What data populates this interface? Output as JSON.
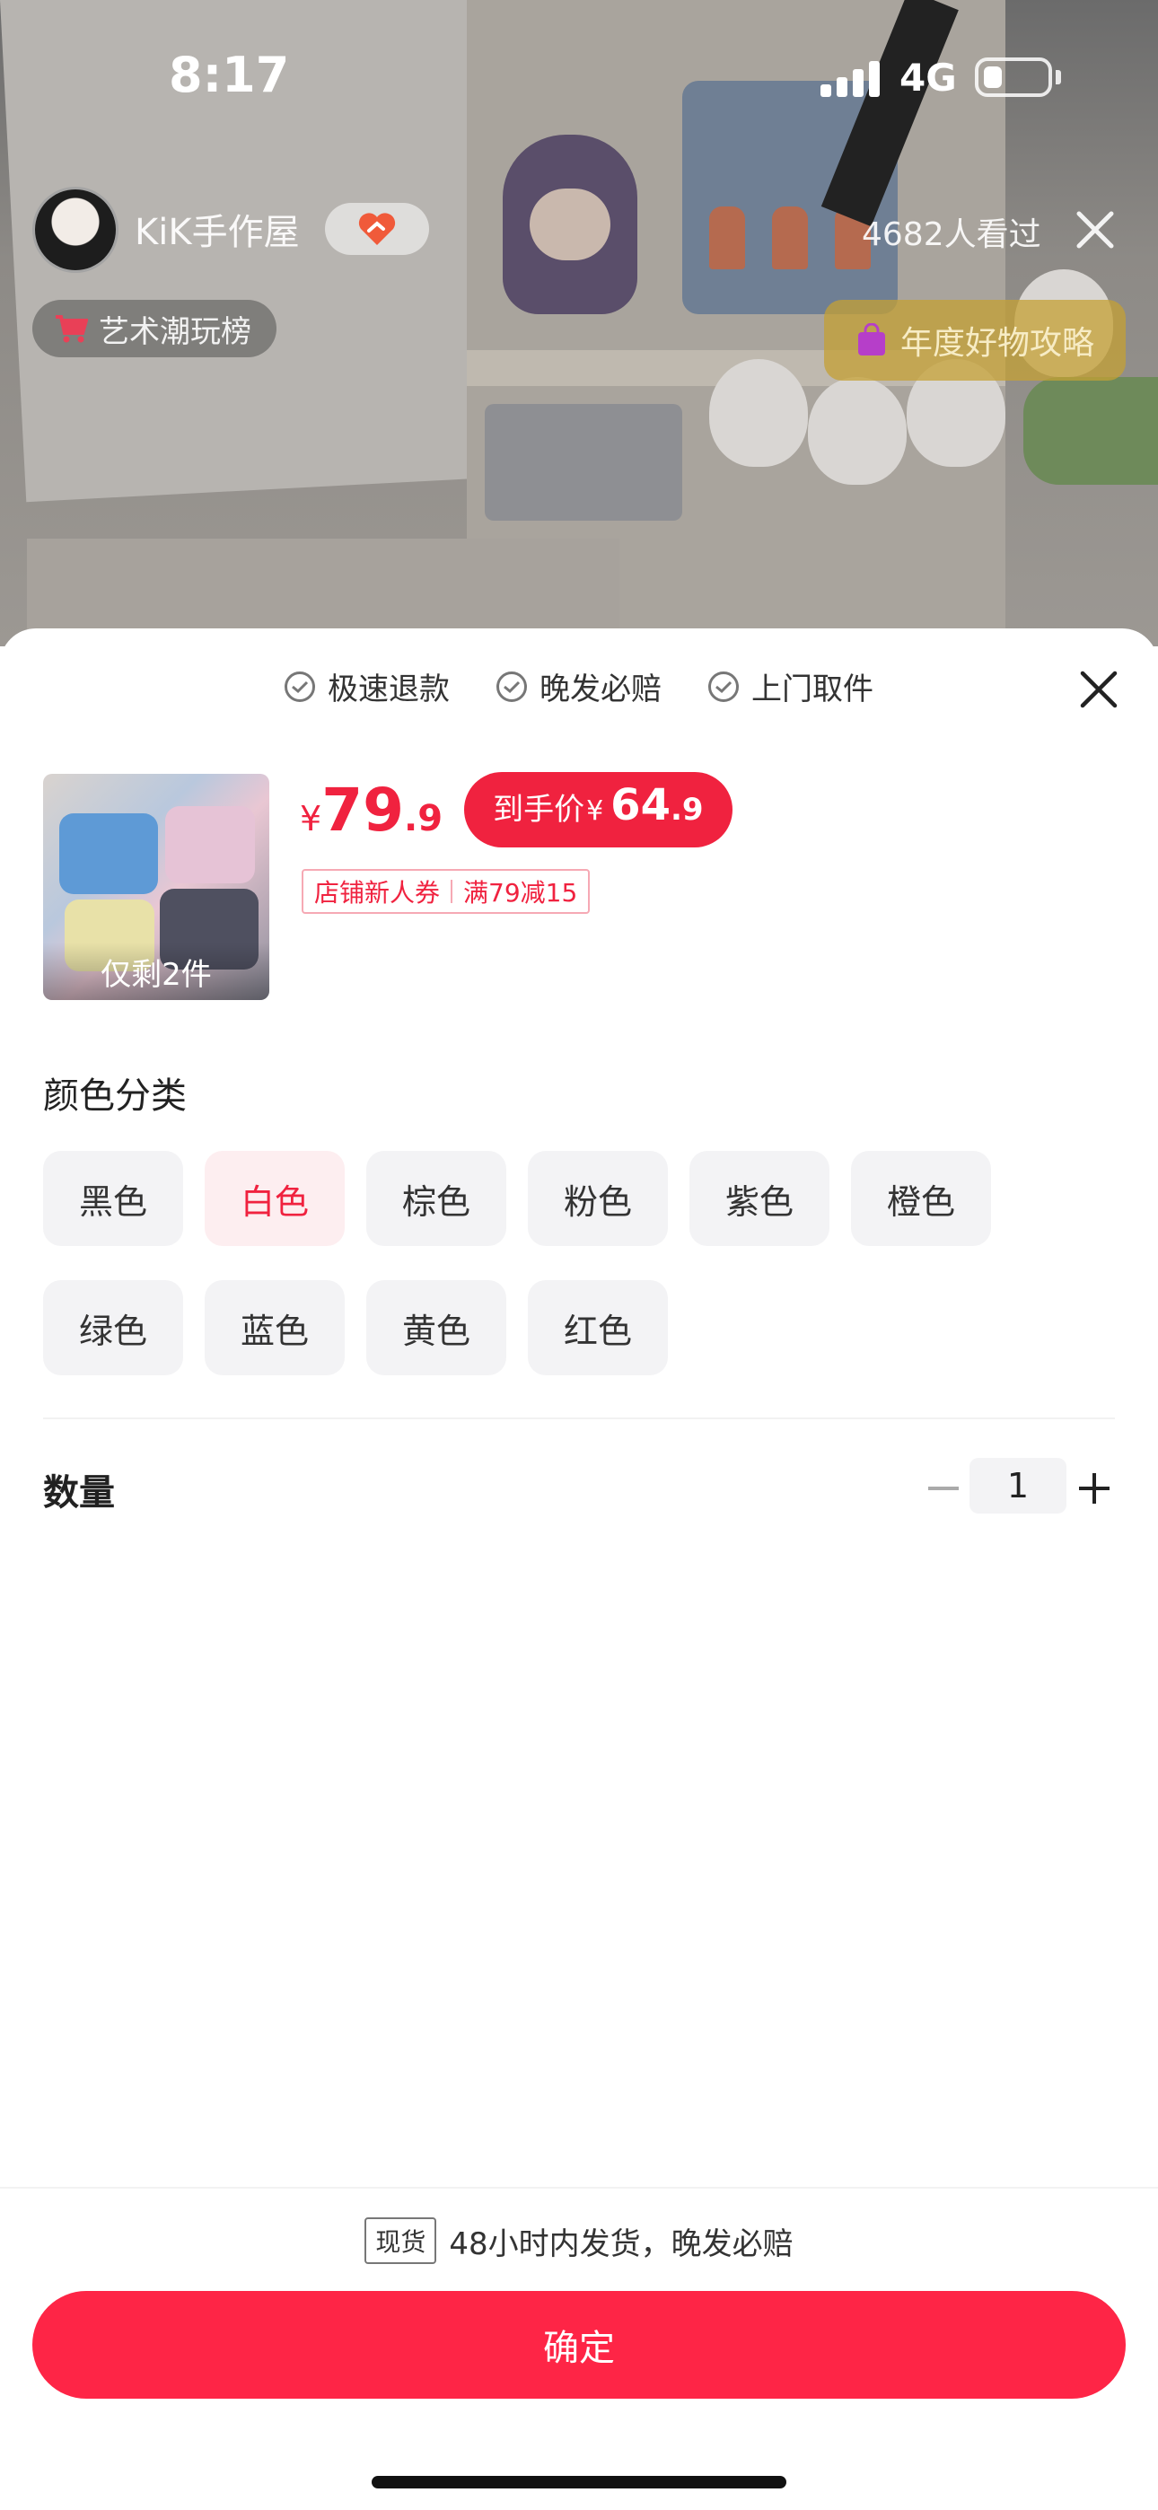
{
  "status_bar": {
    "time": "8:17",
    "network": "4G",
    "battery_level": 0.3
  },
  "live": {
    "shop_name": "KiK手作屋",
    "viewers": "4682人看过",
    "rank_tag": "艺术潮玩榜",
    "guide_tag": "年度好物攻略"
  },
  "sheet": {
    "guarantees": [
      "极速退款",
      "晚发必赔",
      "上门取件"
    ],
    "product": {
      "stock_note": "仅剩2件"
    },
    "price": {
      "currency": "¥",
      "integer": "79",
      "decimal": ".9",
      "final_label": "到手价",
      "final_integer": "64",
      "final_decimal": ".9"
    },
    "coupon": {
      "name": "店铺新人券",
      "rule": "满79减15"
    },
    "color_section_title": "颜色分类",
    "colors": [
      "黑色",
      "白色",
      "棕色",
      "粉色",
      "紫色",
      "橙色",
      "绿色",
      "蓝色",
      "黄色",
      "红色"
    ],
    "selected_color": "白色",
    "quantity_label": "数量",
    "quantity": "1"
  },
  "footer": {
    "stock_tag": "现货",
    "shipping_text": "48小时内发货，晚发必赔",
    "confirm_label": "确定"
  },
  "colors": {
    "accent": "#f0223f",
    "confirm_button": "#fe2546",
    "option_bg": "#f3f3f5",
    "selected_bg": "#fdeef0"
  }
}
